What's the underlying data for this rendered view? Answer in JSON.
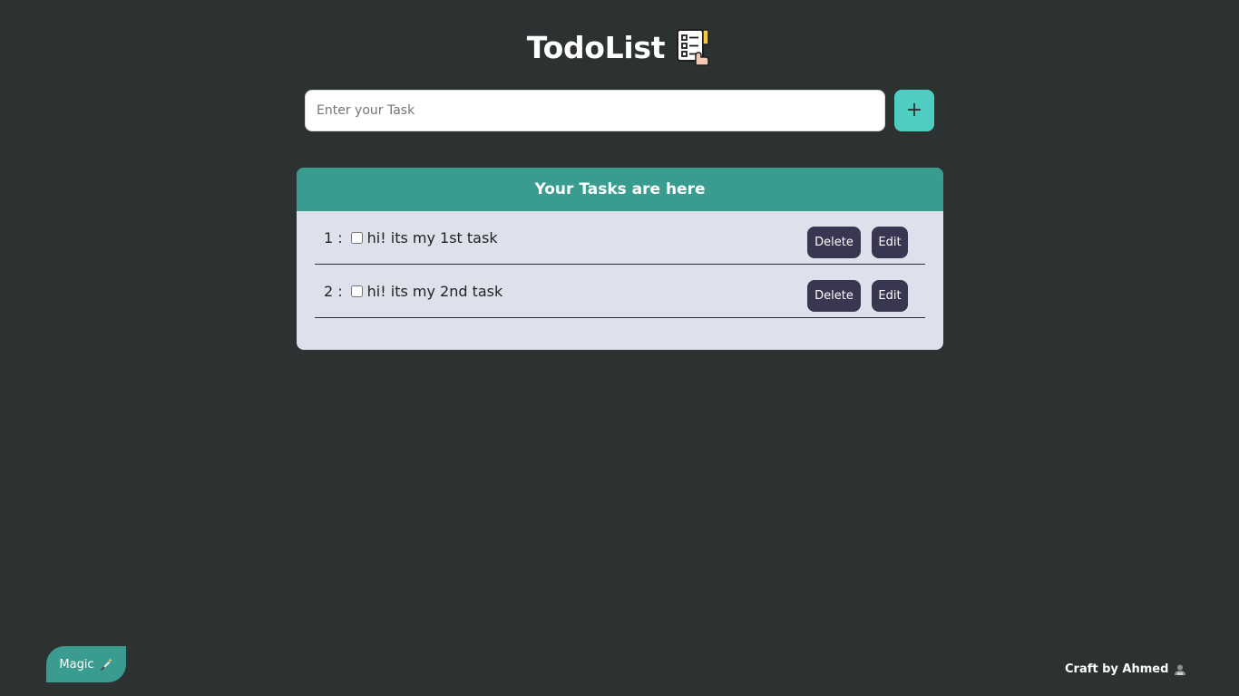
{
  "header": {
    "title": "TodoList",
    "icon": "checklist-icon"
  },
  "form": {
    "placeholder": "Enter your Task",
    "add_label": "+",
    "add_icon": "plus-icon"
  },
  "panel": {
    "heading": "Your Tasks are here"
  },
  "tasks": [
    {
      "number": "1 :",
      "text": "hi! its my 1st task",
      "checked": false,
      "delete_label": "Delete",
      "edit_label": "Edit"
    },
    {
      "number": "2 :",
      "text": "hi! its my 2nd task",
      "checked": false,
      "delete_label": "Delete",
      "edit_label": "Edit"
    }
  ],
  "footer": {
    "magic_label": "Magic",
    "magic_icon": "magic-wand-icon",
    "credit": "Craft by Ahmed",
    "credit_icon": "person-icon"
  },
  "colors": {
    "background": "#2c3132",
    "accent": "#389c8f",
    "add_button": "#4ecdc0",
    "panel": "#dee1ec",
    "task_button": "#383650"
  }
}
